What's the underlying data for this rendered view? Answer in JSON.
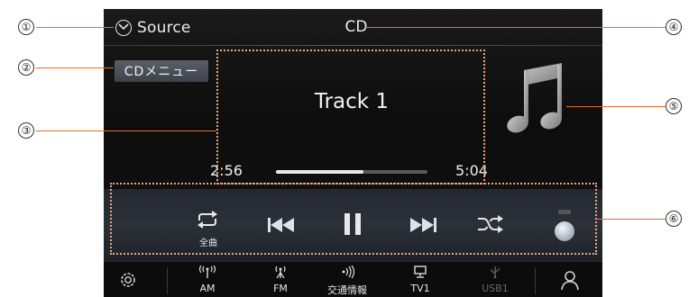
{
  "header": {
    "source_label": "Source",
    "mode_title": "CD"
  },
  "menu": {
    "cd_menu_label": "CDメニュー"
  },
  "now_playing": {
    "track": "Track 1",
    "elapsed": "2:56",
    "total": "5:04",
    "progress_fraction": 0.58
  },
  "controls": {
    "repeat_label": "全曲",
    "buttons": [
      "repeat-icon",
      "previous-track-icon",
      "pause-icon",
      "next-track-icon",
      "shuffle-icon"
    ]
  },
  "bottom_bar": {
    "items": [
      {
        "label": "AM",
        "icon": "antenna-icon"
      },
      {
        "label": "FM",
        "icon": "antenna-icon"
      },
      {
        "label": "交通情報",
        "icon": "broadcast-icon"
      },
      {
        "label": "TV1",
        "icon": "tv-icon"
      },
      {
        "label": "USB1",
        "icon": "usb-icon"
      }
    ]
  },
  "callouts": [
    "①",
    "②",
    "③",
    "④",
    "⑤",
    "⑥"
  ],
  "colors": {
    "screen_bg": "#0d0d0d",
    "callout_line": "#e36c2a",
    "dashed_box": "#e8a680"
  }
}
